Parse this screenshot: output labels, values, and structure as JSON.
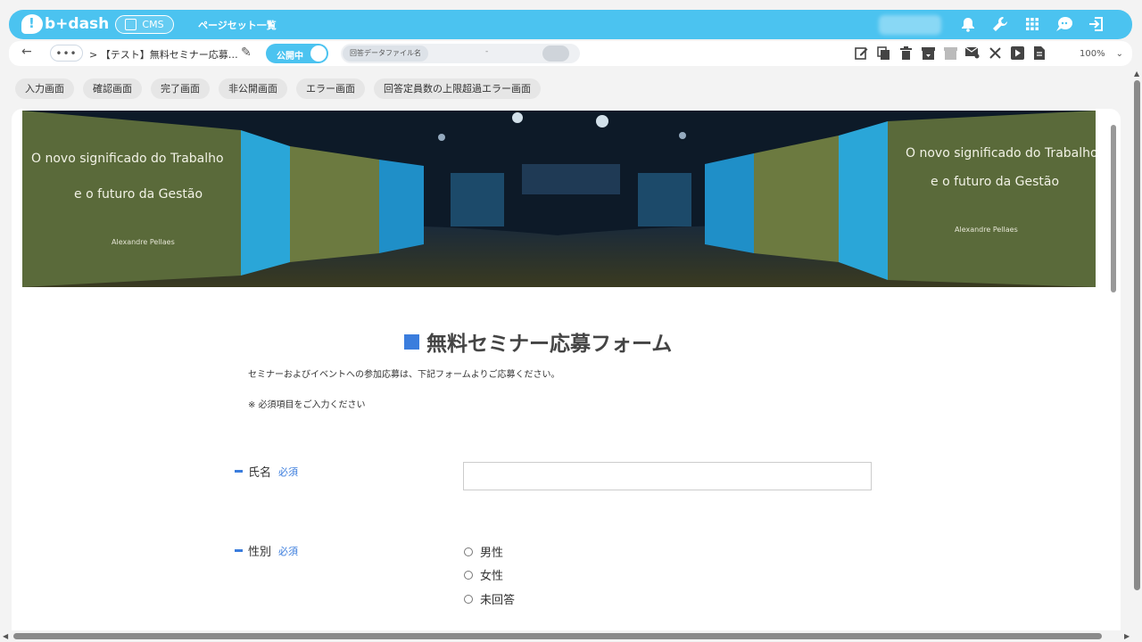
{
  "header": {
    "logo_text": "b+dash",
    "cms_label": "CMS",
    "page_set_label": "ページセット一覧",
    "icons": [
      "bell-icon",
      "wrench-icon",
      "grid-icon",
      "chat-icon",
      "logout-icon"
    ]
  },
  "toolbar": {
    "back_icon": "←",
    "more_label": "•••",
    "breadcrumb": "> 【テスト】無料セミナー応募…",
    "status_label": "公開中",
    "file_label": "回答データファイル名",
    "file_value": "-",
    "zoom": "100%",
    "zoom_arrow": "⌄"
  },
  "tabs": [
    "入力画面",
    "確認画面",
    "完了画面",
    "非公開画面",
    "エラー画面",
    "回答定員数の上限超過エラー画面"
  ],
  "banner": {
    "left_line1": "O novo significado do Trabalho",
    "left_line2": "e o futuro da Gestão",
    "left_name": "Alexandre Pellaes",
    "right_line1": "O novo significado do Trabalho",
    "right_line2": "e o futuro da Gestão",
    "right_name": "Alexandre Pellaes"
  },
  "form": {
    "title": "無料セミナー応募フォーム",
    "intro": "セミナーおよびイベントへの参加応募は、下記フォームよりご応募ください。",
    "note": "※ 必須項目をご入力ください",
    "name_label": "氏名",
    "name_required": "必須",
    "gender_label": "性別",
    "gender_required": "必須",
    "gender_options": [
      "男性",
      "女性",
      "未回答"
    ]
  }
}
